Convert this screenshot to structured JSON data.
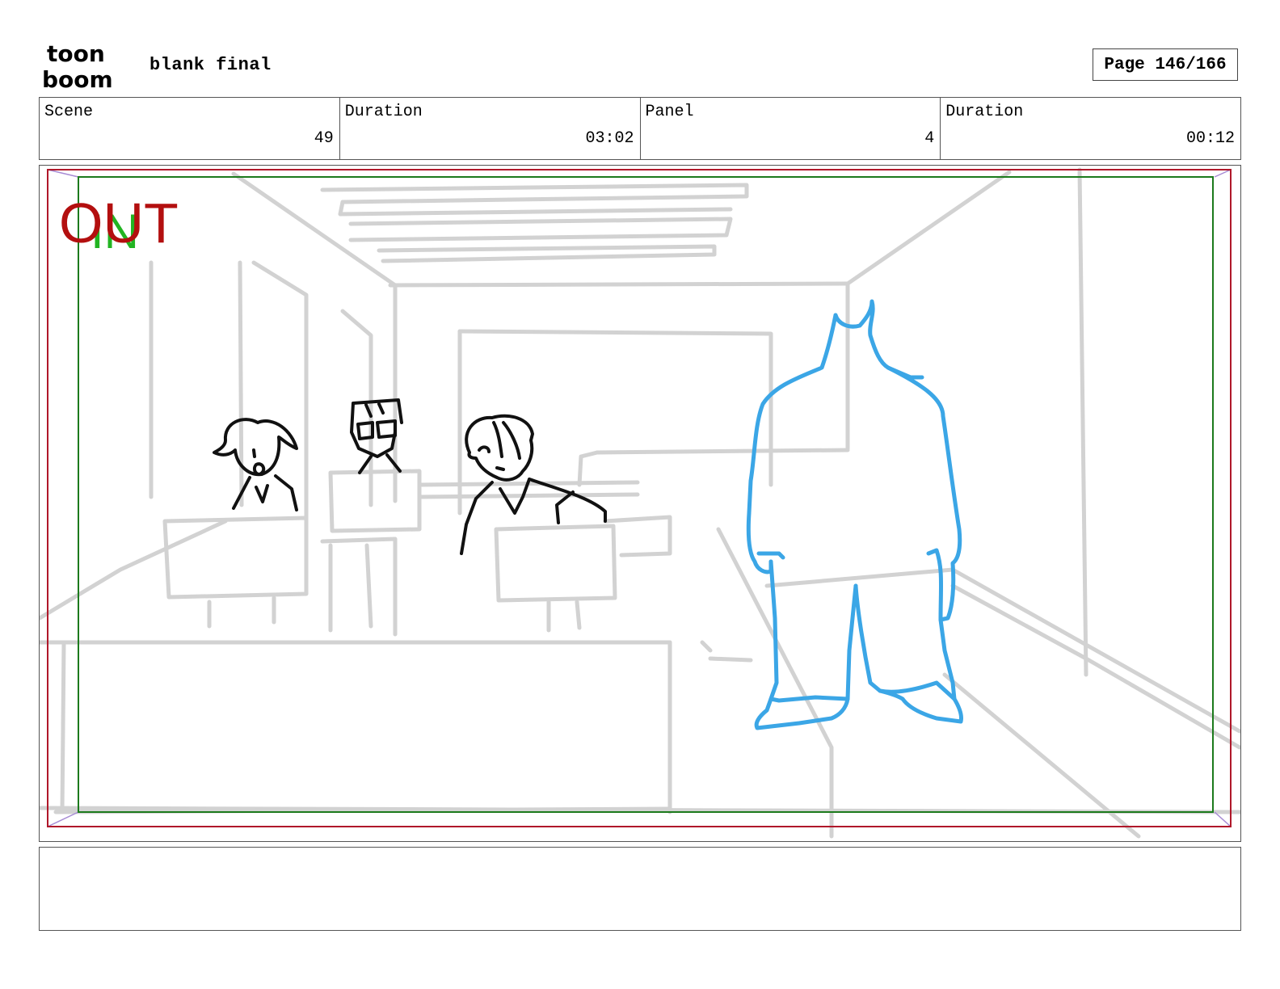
{
  "header": {
    "logo_text_top": "toon",
    "logo_text_bottom": "boom",
    "project_title": "blank final",
    "page_indicator": "Page 146/166"
  },
  "info": {
    "scene_label": "Scene",
    "scene_value": "49",
    "scene_duration_label": "Duration",
    "scene_duration_value": "03:02",
    "panel_label": "Panel",
    "panel_value": "4",
    "panel_duration_label": "Duration",
    "panel_duration_value": "00:12"
  },
  "panel": {
    "out_marker": "OUT",
    "in_marker": "IN",
    "colors": {
      "out_frame": "#b0182a",
      "in_frame": "#1c7a1c",
      "out_text": "#b30f0f",
      "in_text": "#22b422",
      "background_sketch": "#d2d2d2",
      "character_sketch": "#111111",
      "foreground_character": "#3ba6e6"
    }
  },
  "notes": {
    "text": ""
  }
}
